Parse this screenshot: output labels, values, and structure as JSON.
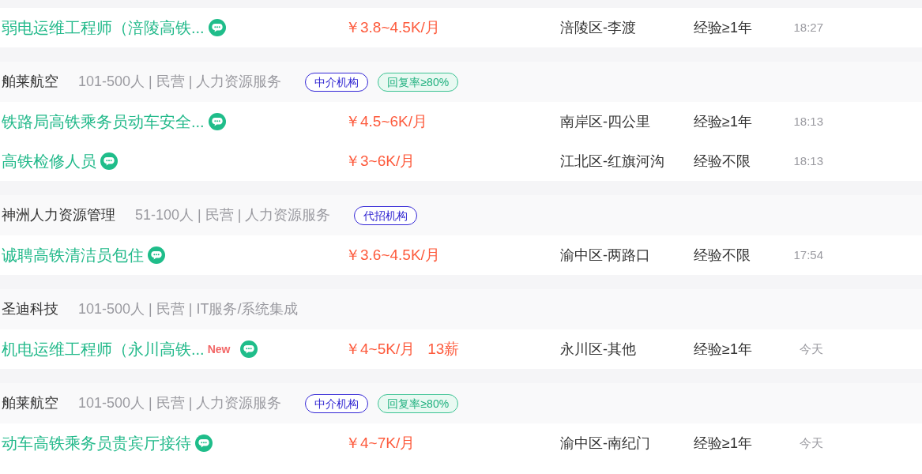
{
  "sections": [
    {
      "jobs": [
        {
          "title": "弱电运维工程师（涪陵高铁...",
          "salary": "￥3.8~4.5K/月",
          "location": "涪陵区-李渡",
          "experience": "经验≥1年",
          "time": "18:27"
        }
      ]
    },
    {
      "company": {
        "name": "舶莱航空",
        "info": "101-500人 | 民营 | 人力资源服务",
        "tags": [
          {
            "label": "中介机构",
            "kind": "agency"
          },
          {
            "label": "回复率≥80%",
            "kind": "reply_rate"
          }
        ]
      },
      "jobs": [
        {
          "title": "铁路局高铁乘务员动车安全...",
          "salary": "￥4.5~6K/月",
          "location": "南岸区-四公里",
          "experience": "经验≥1年",
          "time": "18:13"
        },
        {
          "title": "高铁检修人员",
          "salary": "￥3~6K/月",
          "location": "江北区-红旗河沟",
          "experience": "经验不限",
          "time": "18:13"
        }
      ]
    },
    {
      "company": {
        "name": "神洲人力资源管理",
        "info": "51-100人 | 民营 | 人力资源服务",
        "tags": [
          {
            "label": "代招机构",
            "kind": "agency"
          }
        ]
      },
      "jobs": [
        {
          "title": "诚聘高铁清洁员包住",
          "salary": "￥3.6~4.5K/月",
          "location": "渝中区-两路口",
          "experience": "经验不限",
          "time": "17:54"
        }
      ]
    },
    {
      "company": {
        "name": "圣迪科技",
        "info": "101-500人 | 民营 | IT服务/系统集成"
      },
      "jobs": [
        {
          "title": "机电运维工程师（永川高铁...",
          "badge": "New",
          "salary": "￥4~5K/月",
          "bonus": "13薪",
          "location": "永川区-其他",
          "experience": "经验≥1年",
          "time": "今天"
        }
      ]
    },
    {
      "company": {
        "name": "舶莱航空",
        "info": "101-500人 | 民营 | 人力资源服务",
        "tags": [
          {
            "label": "中介机构",
            "kind": "agency"
          },
          {
            "label": "回复率≥80%",
            "kind": "reply_rate"
          }
        ]
      },
      "jobs": [
        {
          "title": "动车高铁乘务员贵宾厅接待",
          "salary": "￥4~7K/月",
          "location": "渝中区-南纪门",
          "experience": "经验≥1年",
          "time": "今天"
        }
      ]
    }
  ]
}
